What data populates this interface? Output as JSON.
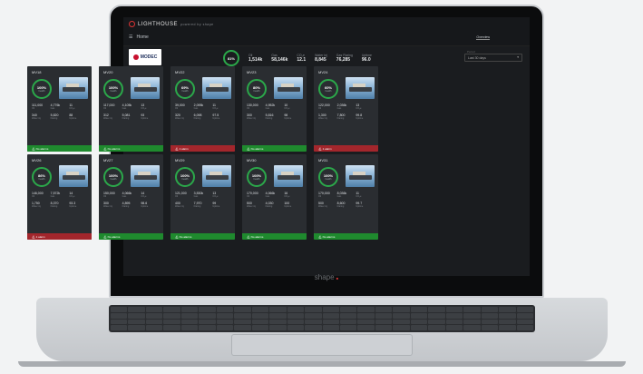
{
  "app": {
    "logo_text": "LIGHTHOUSE",
    "logo_sub": "powered by shape",
    "nav_label": "Home",
    "tabs": [
      "Overview",
      "",
      "",
      ""
    ]
  },
  "header": {
    "company_logo": "MODEC",
    "overall_pct": "81%",
    "stats": [
      {
        "label": "Oil",
        "value": "1,514k"
      },
      {
        "label": "Gas",
        "value": "58,146k"
      },
      {
        "label": "CO₂e",
        "value": "12.1"
      },
      {
        "label": "Water inj",
        "value": "8,845"
      },
      {
        "label": "Gas Flaring",
        "value": "76,285"
      },
      {
        "label": "Uptime",
        "value": "96.0"
      }
    ],
    "range_label": "Period",
    "range_value": "Last 30 days"
  },
  "assets": [
    {
      "name": "MV18",
      "pct": "100%",
      "m": [
        "111,000",
        "4,776k",
        "11",
        "340",
        "5,820",
        "88"
      ],
      "alarm": "No alarms",
      "alarm_ok": true
    },
    {
      "name": "MV20",
      "pct": "100%",
      "m": [
        "117,000",
        "4,105k",
        "13",
        "312",
        "5,081",
        "93"
      ],
      "alarm": "No alarms",
      "alarm_ok": true
    },
    {
      "name": "MV22",
      "pct": "69%",
      "m": [
        "39,000",
        "2,095k",
        "11",
        "320",
        "6,098",
        "97.5"
      ],
      "alarm": "1 alarm",
      "alarm_ok": false
    },
    {
      "name": "MV23",
      "pct": "80%",
      "m": [
        "130,000",
        "4,952k",
        "10",
        "300",
        "5,816",
        "98"
      ],
      "alarm": "No alarms",
      "alarm_ok": true
    },
    {
      "name": "MV24",
      "pct": "60%",
      "m": [
        "122,000",
        "2,036k",
        "13",
        "1,300",
        "7,800",
        "99.8"
      ],
      "alarm": "1 alarm",
      "alarm_ok": false
    },
    {
      "name": "MV26",
      "pct": "86%",
      "m": [
        "146,000",
        "7,572k",
        "14",
        "1,750",
        "8,370",
        "93.3"
      ],
      "alarm": "1 alarm",
      "alarm_ok": false
    },
    {
      "name": "MV27",
      "pct": "100%",
      "m": [
        "150,000",
        "4,066k",
        "14",
        "300",
        "4,895",
        "98.6"
      ],
      "alarm": "No alarms",
      "alarm_ok": true
    },
    {
      "name": "MV29",
      "pct": "100%",
      "m": [
        "121,000",
        "3,530k",
        "13",
        "400",
        "7,970",
        "99"
      ],
      "alarm": "No alarms",
      "alarm_ok": true
    },
    {
      "name": "MV30",
      "pct": "100%",
      "m": [
        "170,000",
        "4,066k",
        "16",
        "500",
        "4,030",
        "100"
      ],
      "alarm": "No alarms",
      "alarm_ok": true
    },
    {
      "name": "MV31",
      "pct": "100%",
      "m": [
        "170,000",
        "8,036k",
        "11",
        "500",
        "8,600",
        "99.7"
      ],
      "alarm": "No alarms",
      "alarm_ok": true
    }
  ],
  "metric_labels": [
    "Oil",
    "Gas",
    "CO₂e",
    "Water inj",
    "Flaring",
    "Uptime"
  ],
  "brand": "shape"
}
